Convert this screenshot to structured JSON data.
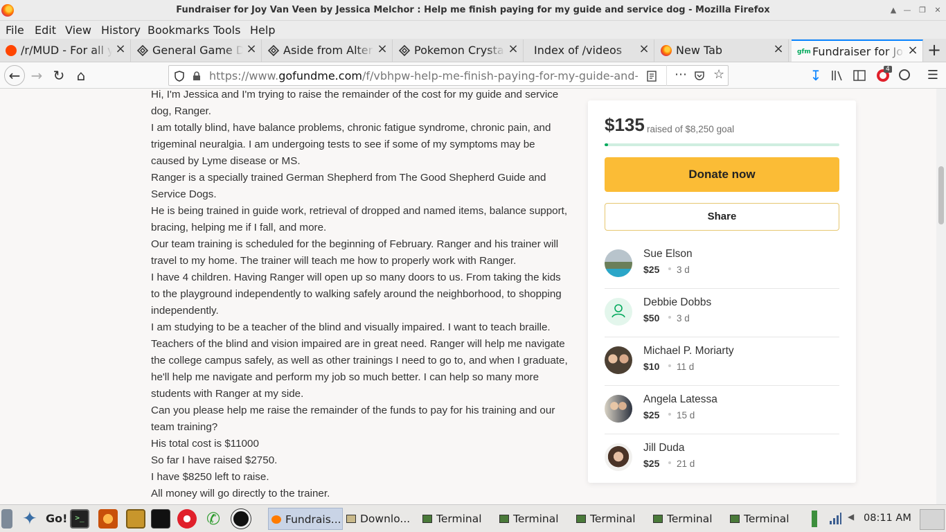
{
  "window": {
    "title": "Fundraiser for Joy Van Veen by Jessica Melchor : Help me finish paying for my guide and service dog - Mozilla Firefox"
  },
  "menubar": [
    "File",
    "Edit",
    "View",
    "History",
    "Bookmarks",
    "Tools",
    "Help"
  ],
  "tabs": [
    {
      "label": "/r/MUD - For all yo",
      "icon": "reddit-icon"
    },
    {
      "label": "General Game Dis",
      "icon": "diamond-icon"
    },
    {
      "label": "Aside from Alter a",
      "icon": "diamond-icon"
    },
    {
      "label": "Pokemon Crystal",
      "icon": "diamond-icon"
    },
    {
      "label": "Index of /videos",
      "icon": "none"
    },
    {
      "label": "New Tab",
      "icon": "firefox-icon"
    },
    {
      "label": "Fundraiser for Joy",
      "icon": "gofundme-icon"
    }
  ],
  "navbar": {
    "url_prefix": "https://www.",
    "url_domain": "gofundme.com",
    "url_path": "/f/vbhpw-help-me-finish-paying-for-my-guide-and-servi",
    "badge_count": "4"
  },
  "story": [
    "Hi, I'm Jessica and I'm trying to raise the remainder of the cost for my guide and service dog, Ranger.",
    "I am totally blind, have balance problems, chronic fatigue syndrome, chronic pain, and trigeminal neuralgia. I am undergoing tests to see if some of my symptoms may be caused by Lyme disease or MS.",
    "Ranger is a specially trained German Shepherd from The Good Shepherd Guide and Service Dogs.",
    "He is being trained in guide work, retrieval of dropped and named items, balance support, bracing, helping me if I fall, and more.",
    "Our team training is scheduled for the beginning of February. Ranger and his trainer will travel to my home. The trainer will teach me how to properly work with Ranger.",
    "I have 4 children. Having Ranger will open up so many doors to us. From taking the kids to the playground independently to walking safely around the neighborhood, to shopping independently.",
    "I am studying to be a teacher of the blind and visually impaired. I want to teach braille. Teachers of the blind and vision impaired are in great need. Ranger will help me navigate the college campus safely, as well as other trainings I need to go to, and when I graduate, he'll help me navigate and perform my job so much better. I can help so many more students with Ranger at my side.",
    "Can you please help me raise the remainder of the funds to pay for his training and our team training?",
    "His total cost is $11000",
    "So far I have raised $2750.",
    "I have $8250 left to raise.",
    "All money will go directly to the trainer."
  ],
  "card": {
    "raised": "$135",
    "goal_text": "raised of $8,250 goal",
    "progress_fraction": 0.016,
    "donate_label": "Donate now",
    "share_label": "Share",
    "donors": [
      {
        "name": "Sue Elson",
        "amount": "$25",
        "time": "3 d",
        "avatar": "photo"
      },
      {
        "name": "Debbie Dobbs",
        "amount": "$50",
        "time": "3 d",
        "avatar": "placeholder"
      },
      {
        "name": "Michael P. Moriarty",
        "amount": "$10",
        "time": "11 d",
        "avatar": "photo"
      },
      {
        "name": "Angela Latessa",
        "amount": "$25",
        "time": "15 d",
        "avatar": "photo"
      },
      {
        "name": "Jill Duda",
        "amount": "$25",
        "time": "21 d",
        "avatar": "photo"
      }
    ]
  },
  "taskbar": {
    "go_label": "Go!",
    "tasks": [
      "Fundrais...",
      "Downlo...",
      "Terminal",
      "Terminal",
      "Terminal",
      "Terminal",
      "Terminal"
    ],
    "clock": "08:11 AM"
  },
  "colors": {
    "accent": "#0a84ff",
    "donate": "#fbbc36",
    "progress": "#02a95c"
  }
}
